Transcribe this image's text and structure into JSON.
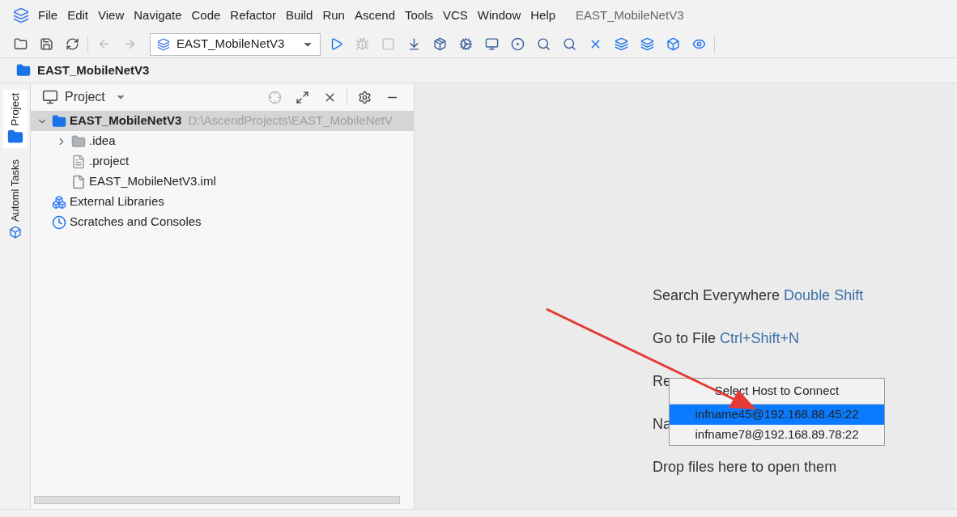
{
  "menu": [
    "File",
    "Edit",
    "View",
    "Navigate",
    "Code",
    "Refactor",
    "Build",
    "Run",
    "Ascend",
    "Tools",
    "VCS",
    "Window",
    "Help"
  ],
  "window": {
    "title": "EAST_MobileNetV3"
  },
  "toolbar": {
    "run_config": "EAST_MobileNetV3"
  },
  "breadcrumb": "EAST_MobileNetV3",
  "side_tabs": [
    {
      "label": "Project",
      "selected": true
    },
    {
      "label": "Automl Tasks",
      "selected": false
    }
  ],
  "project_panel": {
    "title": "Project",
    "tree": [
      {
        "kind": "project",
        "label": "EAST_MobileNetV3",
        "path": "D:\\AscendProjects\\EAST_MobileNetV",
        "expanded": true,
        "selected": true,
        "children": [
          {
            "kind": "folder",
            "label": ".idea",
            "expanded": false,
            "selected": false
          },
          {
            "kind": "file",
            "label": ".project",
            "selected": false
          },
          {
            "kind": "iml",
            "label": "EAST_MobileNetV3.iml",
            "selected": false
          }
        ]
      },
      {
        "kind": "libraries",
        "label": "External Libraries",
        "selected": false
      },
      {
        "kind": "scratches",
        "label": "Scratches and Consoles",
        "selected": false
      }
    ]
  },
  "editor_hints": [
    {
      "label": "Search Everywhere",
      "shortcut": "Double Shift"
    },
    {
      "label": "Go to File",
      "shortcut": "Ctrl+Shift+N"
    },
    {
      "label": "Re"
    },
    {
      "label": "Na"
    },
    {
      "label": "Drop files here to open them"
    }
  ],
  "host_popup": {
    "title": "Select Host to Connect",
    "hosts": [
      {
        "label": "infname45@192.168.88.45:22",
        "selected": true
      },
      {
        "label": "infname78@192.168.89.78:22",
        "selected": false
      }
    ]
  }
}
